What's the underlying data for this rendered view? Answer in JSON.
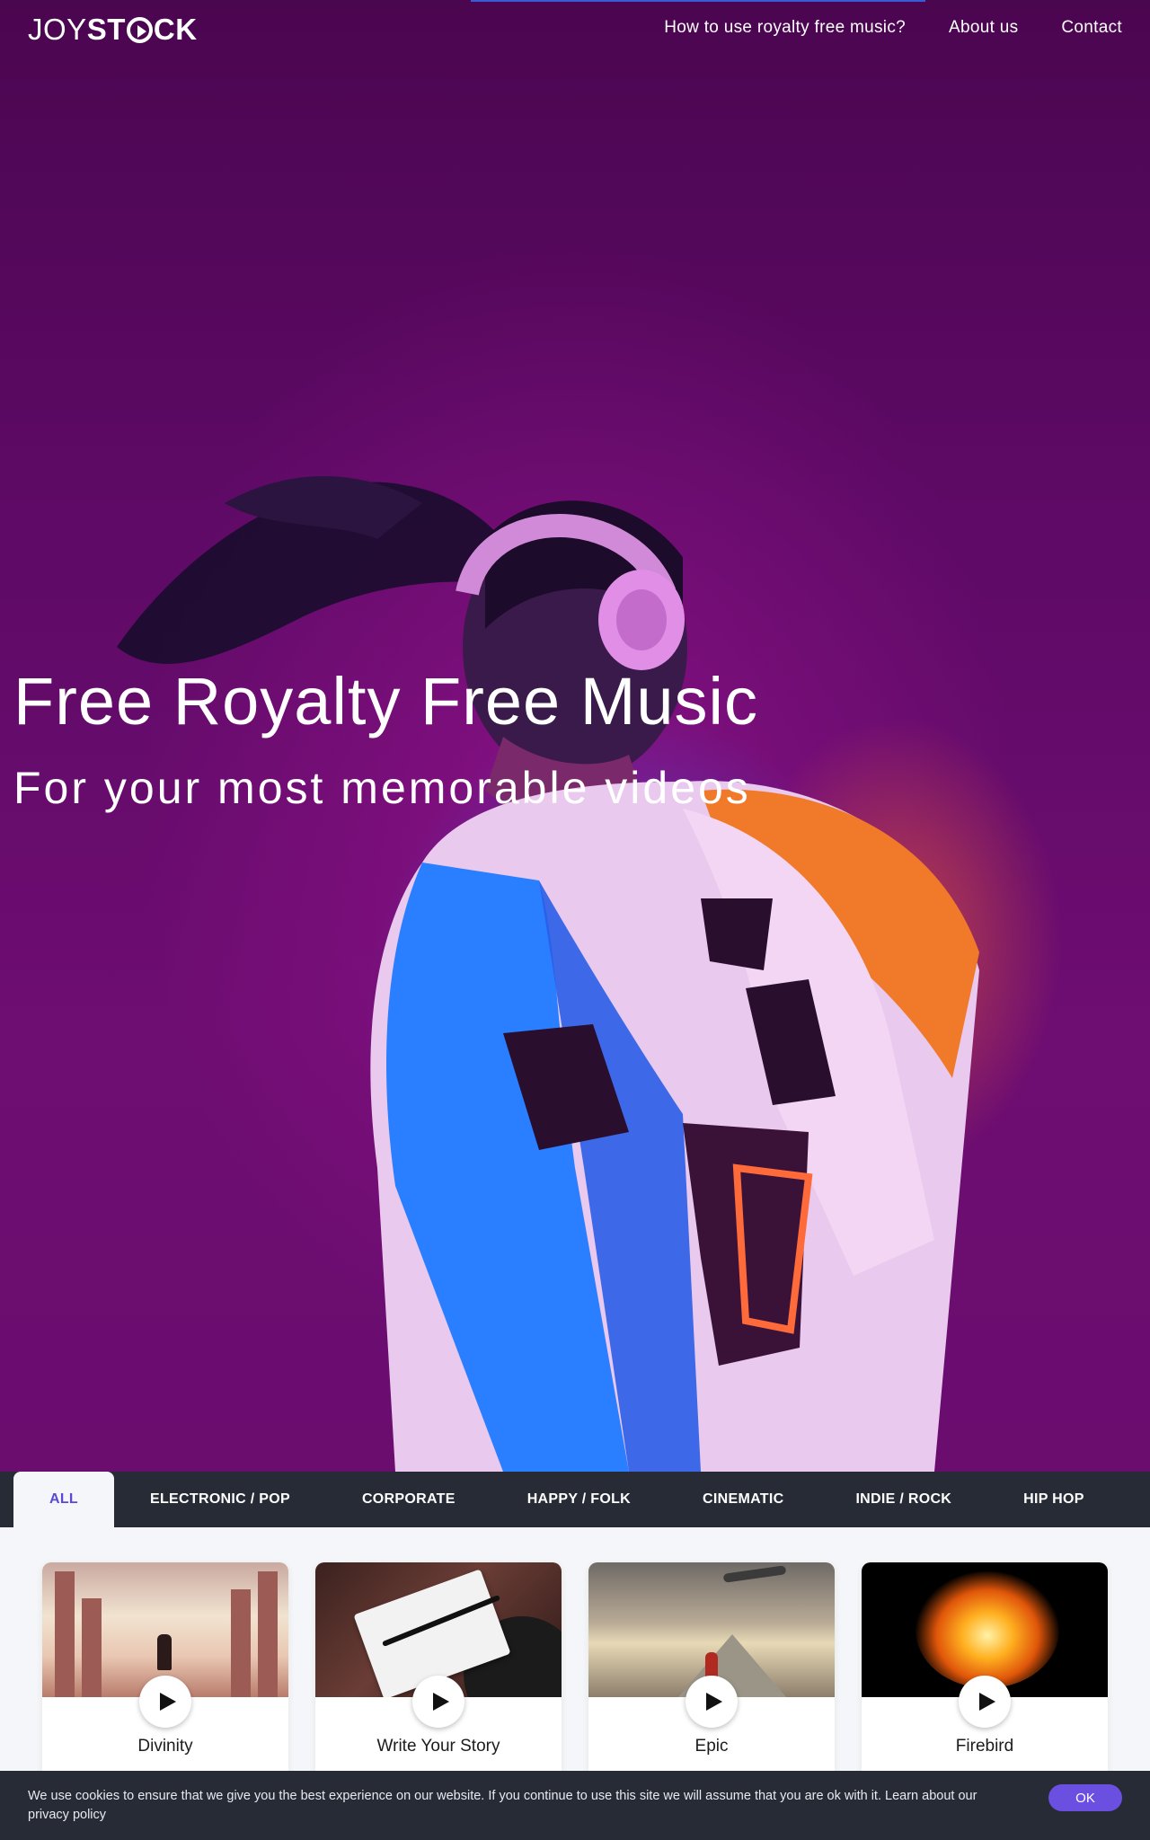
{
  "brand": {
    "logo_light": "JOY",
    "logo_bold_1": "ST",
    "logo_bold_2": "CK"
  },
  "nav": {
    "links": [
      "How to use royalty free music?",
      "About us",
      "Contact"
    ]
  },
  "hero": {
    "title": "Free Royalty Free Music",
    "subtitle": "For your most memorable videos"
  },
  "tabs": [
    "ALL",
    "ELECTRONIC / POP",
    "CORPORATE",
    "HAPPY / FOLK",
    "CINEMATIC",
    "INDIE / ROCK",
    "HIP HOP"
  ],
  "active_tab": "ALL",
  "tracks": [
    {
      "title": "Divinity"
    },
    {
      "title": "Write Your Story"
    },
    {
      "title": "Epic"
    },
    {
      "title": "Firebird"
    }
  ],
  "cookie": {
    "text": "We use cookies to ensure that we give you the best experience on our website. If you continue to use this site we will assume that you are ok with it. Learn about our privacy policy",
    "ok_label": "OK"
  },
  "colors": {
    "accent": "#6a4fe0",
    "dark_bar": "#262b36",
    "hero_purple": "#5e0a66"
  }
}
